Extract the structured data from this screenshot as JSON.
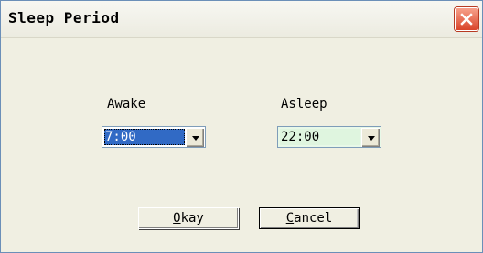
{
  "window": {
    "title": "Sleep Period"
  },
  "awake": {
    "label": "Awake",
    "value": "7:00"
  },
  "asleep": {
    "label": "Asleep",
    "value": "22:00"
  },
  "buttons": {
    "okay_mnemonic": "O",
    "okay_rest": "kay",
    "cancel_mnemonic": "C",
    "cancel_rest": "ancel"
  },
  "icons": {
    "close": "close-icon",
    "dropdown": "chevron-down-icon"
  },
  "colors": {
    "close_button": "#d9442a",
    "selection": "#316ac5",
    "asleep_field": "#dff5df"
  }
}
